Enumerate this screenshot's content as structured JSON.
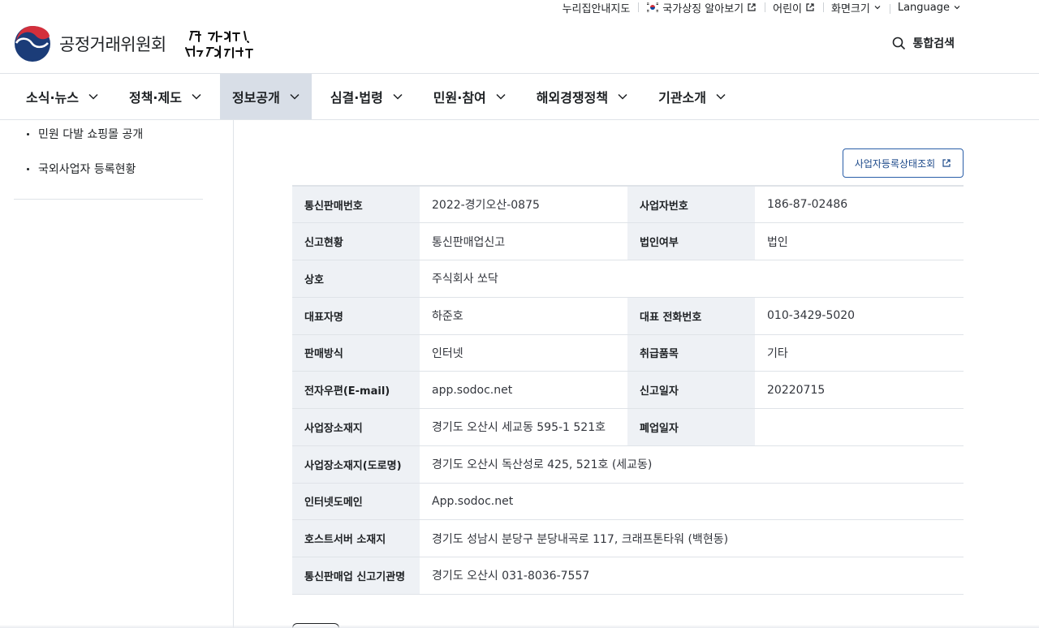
{
  "utility": {
    "sitemap": "누리집안내지도",
    "national_symbol": "국가상징 알아보기",
    "kids": "어린이",
    "screen_size": "화면크기",
    "language": "Language"
  },
  "header": {
    "logo_text": "공정거래위원회",
    "search_label": "통합검색"
  },
  "gnb": [
    {
      "label": "소식·뉴스"
    },
    {
      "label": "정책·제도"
    },
    {
      "label": "정보공개",
      "active": true
    },
    {
      "label": "심결·법령"
    },
    {
      "label": "민원·참여"
    },
    {
      "label": "해외경쟁정책"
    },
    {
      "label": "기관소개"
    }
  ],
  "lnb": [
    {
      "label": "민원 다발 쇼핑몰 공개"
    },
    {
      "label": "국외사업자 등록현황"
    }
  ],
  "content": {
    "status_button": "사업자등록상태조회",
    "rows": [
      {
        "h1": "통신판매번호",
        "v1": "2022-경기오산-0875",
        "h2": "사업자번호",
        "v2": "186-87-02486"
      },
      {
        "h1": "신고현황",
        "v1": "통신판매업신고",
        "h2": "법인여부",
        "v2": "법인"
      },
      {
        "h1": "상호",
        "v1": "주식회사 쏘닥"
      },
      {
        "h1": "대표자명",
        "v1": "하준호",
        "h2": "대표 전화번호",
        "v2": "010-3429-5020"
      },
      {
        "h1": "판매방식",
        "v1": "인터넷",
        "h2": "취급품목",
        "v2": "기타"
      },
      {
        "h1": "전자우편(E-mail)",
        "v1": "app.sodoc.net",
        "h2": "신고일자",
        "v2": "20220715"
      },
      {
        "h1": "사업장소재지",
        "v1": "경기도 오산시 세교동 595-1 521호",
        "h2": "폐업일자",
        "v2": ""
      },
      {
        "h1": "사업장소재지(도로명)",
        "v1": "경기도 오산시 독산성로 425, 521호 (세교동)"
      },
      {
        "h1": "인터넷도메인",
        "v1": "App.sodoc.net"
      },
      {
        "h1": "호스트서버 소재지",
        "v1": "경기도 성남시 분당구 분당내곡로 117, 크래프톤타워 (백현동)"
      },
      {
        "h1": "통신판매업 신고기관명",
        "v1": "경기도 오산시 031-8036-7557"
      }
    ]
  },
  "colors": {
    "accent": "#2a5ea8",
    "header_cell_bg": "#eef1f5",
    "gnb_active_bg": "#d8dee7"
  }
}
